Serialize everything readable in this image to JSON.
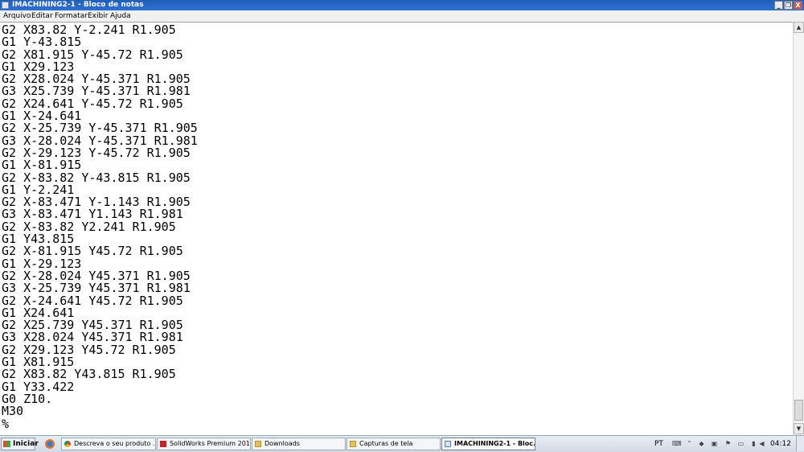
{
  "window": {
    "title": "IMACHINING2-1 - Bloco de notas",
    "controls": {
      "minimize": "_",
      "restore": "❐",
      "close": "X"
    }
  },
  "menu": [
    "Arquivo",
    "Editar",
    "Formatar",
    "Exibir",
    "Ajuda"
  ],
  "editor": {
    "lines": [
      "G2 X83.82 Y-2.241 R1.905",
      "G1 Y-43.815",
      "G2 X81.915 Y-45.72 R1.905",
      "G1 X29.123",
      "G2 X28.024 Y-45.371 R1.905",
      "G3 X25.739 Y-45.371 R1.981",
      "G2 X24.641 Y-45.72 R1.905",
      "G1 X-24.641",
      "G2 X-25.739 Y-45.371 R1.905",
      "G3 X-28.024 Y-45.371 R1.981",
      "G2 X-29.123 Y-45.72 R1.905",
      "G1 X-81.915",
      "G2 X-83.82 Y-43.815 R1.905",
      "G1 Y-2.241",
      "G2 X-83.471 Y-1.143 R1.905",
      "G3 X-83.471 Y1.143 R1.981",
      "G2 X-83.82 Y2.241 R1.905",
      "G1 Y43.815",
      "G2 X-81.915 Y45.72 R1.905",
      "G1 X-29.123",
      "G2 X-28.024 Y45.371 R1.905",
      "G3 X-25.739 Y45.371 R1.981",
      "G2 X-24.641 Y45.72 R1.905",
      "G1 X24.641",
      "G2 X25.739 Y45.371 R1.905",
      "G3 X28.024 Y45.371 R1.981",
      "G2 X29.123 Y45.72 R1.905",
      "G1 X81.915",
      "G2 X83.82 Y43.815 R1.905",
      "G1 Y33.422",
      "G0 Z10.",
      "M30",
      "%"
    ]
  },
  "taskbar": {
    "start_label": "Iniciar",
    "items": [
      {
        "label": "Descreva o seu produto ...",
        "icon": "chrome-icon",
        "active": false
      },
      {
        "label": "SolidWorks Premium 201...",
        "icon": "solidworks-icon",
        "active": false
      },
      {
        "label": "Downloads",
        "icon": "folder-icon",
        "active": false
      },
      {
        "label": "Capturas de tela",
        "icon": "folder-icon",
        "active": false
      },
      {
        "label": "IMACHINING2-1 - Bloc...",
        "icon": "notepad-icon",
        "active": true
      }
    ],
    "language": "PT",
    "clock": "04:12"
  },
  "colors": {
    "titlebar": "#1f5fb8",
    "taskbar": "#d2dae5",
    "active_task": "#ffffff"
  }
}
